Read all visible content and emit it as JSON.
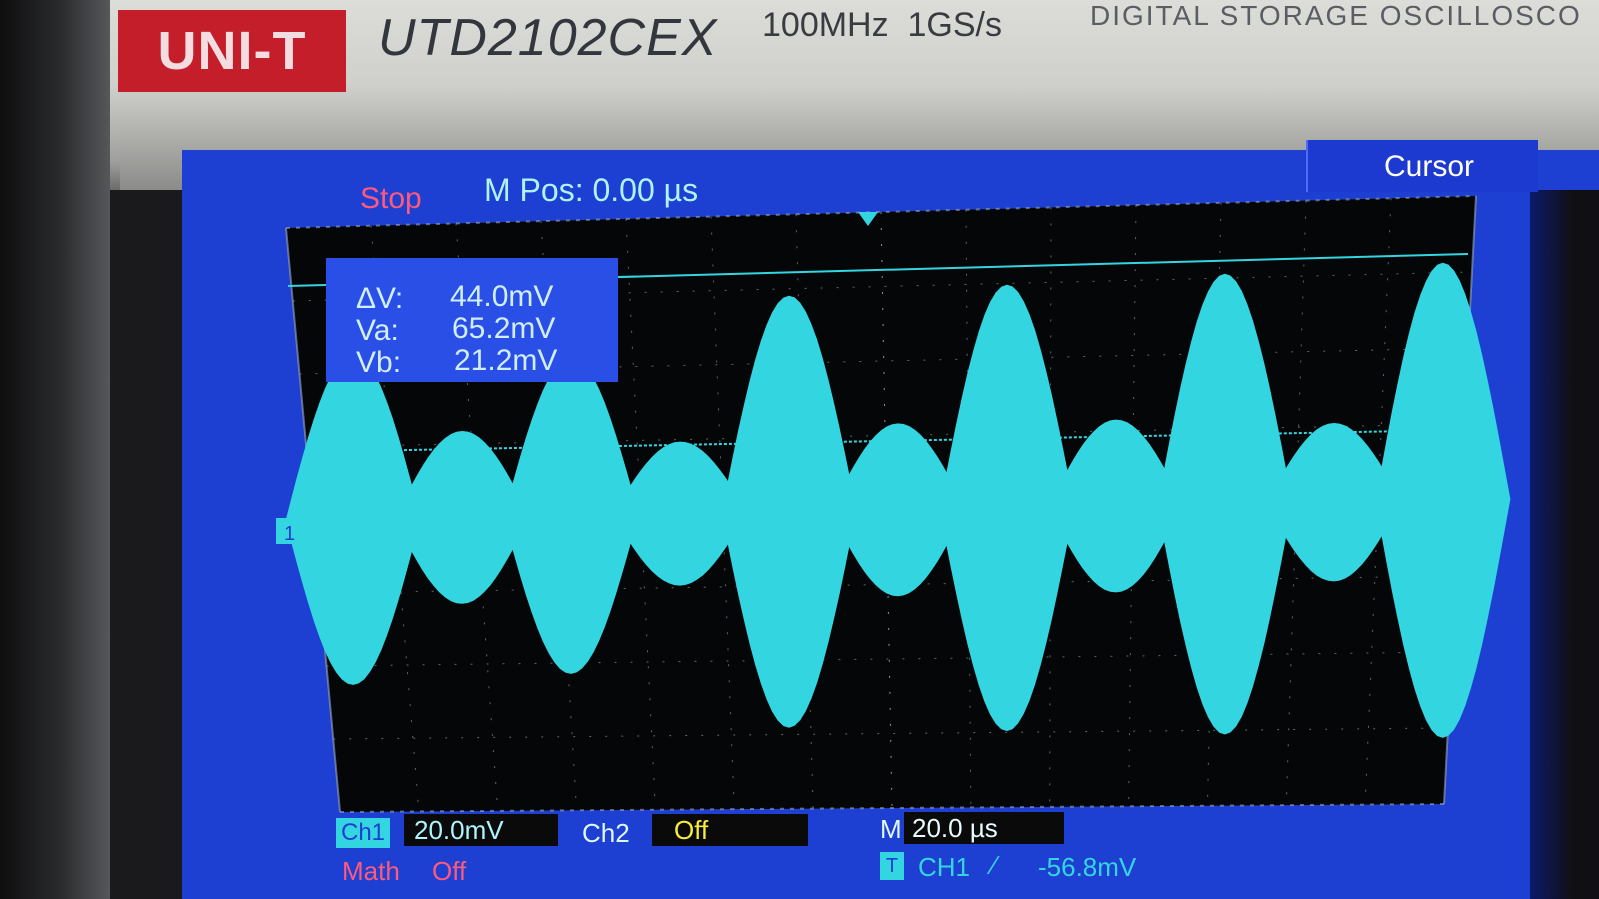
{
  "device": {
    "brand": "UNI-T",
    "model": "UTD2102CEX",
    "specs": "100MHz  1GS/s",
    "product_line": "DIGITAL STORAGE OSCILLOSCO"
  },
  "status": {
    "run_state": "Stop",
    "m_pos": "M Pos: 0.00 µs"
  },
  "menu": {
    "cursor_label": "Cursor"
  },
  "cursor_readout": {
    "rows": [
      {
        "label": "ΔV:",
        "value": "44.0mV"
      },
      {
        "label": "Va:",
        "value": "65.2mV"
      },
      {
        "label": "Vb:",
        "value": "21.2mV"
      }
    ]
  },
  "channels": {
    "ch1_label": "Ch1",
    "ch1_scale": "20.0mV",
    "ch2_label": "Ch2",
    "ch2_state": "Off",
    "math_label": "Math",
    "math_state": "Off"
  },
  "timebase": {
    "prefix": "M",
    "value": "20.0 µs"
  },
  "trigger": {
    "badge": "T",
    "source": "CH1",
    "slope_symbol": "∕",
    "level": "-56.8mV"
  },
  "channel_marker": "1",
  "colors": {
    "screen_bg": "#1d3fd2",
    "grid_bg": "#050608",
    "trace": "#33d6e0",
    "stop_red": "#ff5a7a",
    "off_yellow": "#f5ee3a",
    "brand_red": "#c41e2a"
  },
  "chart_data": {
    "type": "line",
    "waveform": "amplitude-modulated sinusoid (beating envelope)",
    "envelope_peaks_divisions": [
      2.3,
      1.2,
      2.2,
      1.0,
      3.0,
      1.2,
      3.1,
      1.2,
      3.2,
      1.1,
      3.3
    ],
    "grid": true
  }
}
